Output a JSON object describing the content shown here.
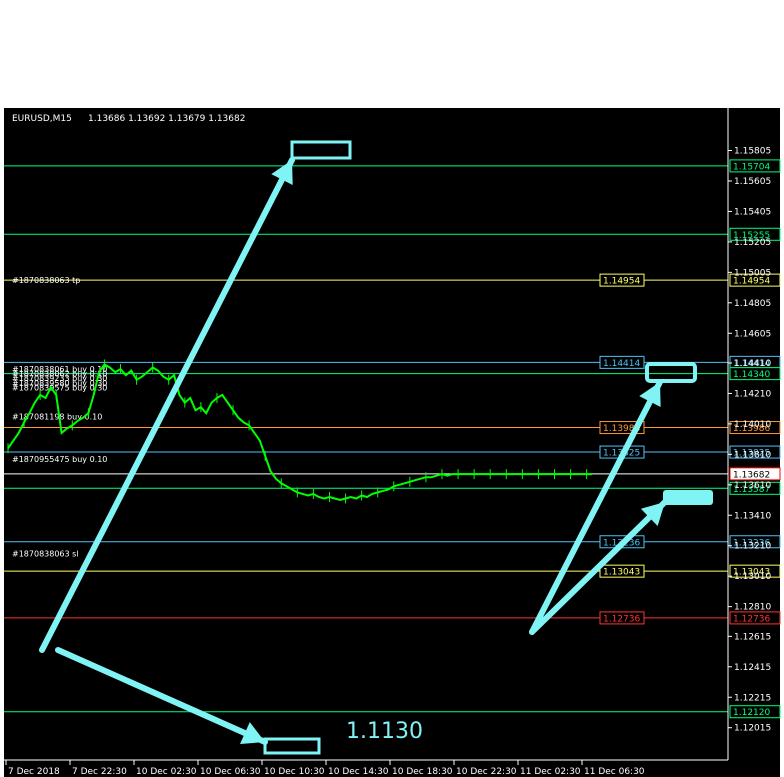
{
  "header": {
    "symbol": "EURUSD,M15",
    "ohlc": "1.13686 1.13692 1.13679 1.13682"
  },
  "colors": {
    "bg": "#000000",
    "axis": "#ffffff",
    "candle": "#00ff00",
    "green_line": "#00ff7f",
    "yellow_line": "#ffff66",
    "blue_line": "#4fc3f7",
    "orange_line": "#ff9933",
    "red_line": "#ff3333",
    "arrow": "#80f4f4"
  },
  "chart_data": {
    "type": "line",
    "title": "",
    "ylim": [
      1.12,
      1.1592
    ],
    "y_ticks": [
      "1.15805",
      "1.15605",
      "1.15405",
      "1.15205",
      "1.15005",
      "1.14805",
      "1.14605",
      "1.14410",
      "1.14210",
      "1.14010",
      "1.13810",
      "1.13610",
      "1.13410",
      "1.13210",
      "1.13010",
      "1.12810",
      "1.12615",
      "1.12415",
      "1.12215",
      "1.12015"
    ],
    "x_ticks": [
      "7 Dec 2018",
      "7 Dec 22:30",
      "10 Dec 02:30",
      "10 Dec 06:30",
      "10 Dec 10:30",
      "10 Dec 14:30",
      "10 Dec 18:30",
      "10 Dec 22:30",
      "11 Dec 02:30",
      "11 Dec 06:30"
    ],
    "price_levels": [
      {
        "price": 1.15704,
        "label": "1.15704",
        "style": "green"
      },
      {
        "price": 1.15255,
        "label": "1.15255",
        "style": "green"
      },
      {
        "price": 1.14954,
        "label": "1.14954",
        "style": "yellow"
      },
      {
        "price": 1.14414,
        "label": "1.14414",
        "style": "blue"
      },
      {
        "price": 1.1434,
        "label": "1.14340",
        "style": "green"
      },
      {
        "price": 1.13986,
        "label": "1.13986",
        "style": "orange"
      },
      {
        "price": 1.13825,
        "label": "1.13825",
        "style": "blue"
      },
      {
        "price": 1.13682,
        "label": "1.13682",
        "style": "current"
      },
      {
        "price": 1.13587,
        "label": "1.13587",
        "style": "green"
      },
      {
        "price": 1.13236,
        "label": "1.13236",
        "style": "blue"
      },
      {
        "price": 1.13043,
        "label": "1.13043",
        "style": "yellow"
      },
      {
        "price": 1.12736,
        "label": "1.12736",
        "style": "red"
      },
      {
        "price": 1.1212,
        "label": "1.12120",
        "style": "green"
      }
    ],
    "order_labels": [
      {
        "price": 1.14954,
        "text": "#1870838063 tp"
      },
      {
        "price": 1.1437,
        "text": "#1870838061 buy 0.10"
      },
      {
        "price": 1.1434,
        "text": "#1870838062 buy 0.10"
      },
      {
        "price": 1.1431,
        "text": "#1870839233 buy 0.30"
      },
      {
        "price": 1.1428,
        "text": "#1870839580 buy 0.30"
      },
      {
        "price": 1.1425,
        "text": "#1870839575 buy 0.30"
      },
      {
        "price": 1.1406,
        "text": "#187081198 buy 0.10"
      },
      {
        "price": 1.1378,
        "text": "#1870955475 buy 0.10"
      },
      {
        "price": 1.1316,
        "text": "#1870838063 sl"
      }
    ],
    "series": [
      {
        "x": [
          0,
          2,
          4,
          6,
          8,
          10,
          12,
          14,
          16,
          18,
          20,
          22,
          24,
          26,
          28,
          30,
          32,
          34,
          36,
          38,
          40,
          42,
          44,
          46,
          48,
          50,
          52,
          54,
          56,
          58,
          60,
          62,
          64,
          66,
          68,
          70,
          72,
          74,
          76,
          78,
          80,
          82,
          84,
          86,
          88,
          90,
          92,
          94,
          96,
          98,
          100,
          102,
          104,
          106,
          108,
          110,
          112,
          114,
          116,
          118,
          120,
          122,
          124,
          126,
          128,
          130,
          132,
          134,
          136,
          138,
          140,
          142,
          144,
          146,
          148,
          150,
          152,
          154,
          156,
          158,
          160,
          162,
          164,
          166,
          168,
          170,
          172,
          174,
          176,
          178,
          180,
          182,
          184,
          186,
          188,
          190,
          192,
          194,
          196,
          198,
          200,
          202,
          204,
          206,
          208,
          210,
          212,
          214,
          216,
          218
        ],
        "values": [
          1.1385,
          1.139,
          1.1395,
          1.1402,
          1.1408,
          1.1415,
          1.142,
          1.1418,
          1.1425,
          1.142,
          1.1395,
          1.1398,
          1.14,
          1.1403,
          1.1405,
          1.1408,
          1.142,
          1.1435,
          1.144,
          1.1438,
          1.1435,
          1.1437,
          1.1433,
          1.1436,
          1.143,
          1.1432,
          1.1435,
          1.1438,
          1.1436,
          1.1432,
          1.143,
          1.1433,
          1.142,
          1.1415,
          1.1418,
          1.141,
          1.1412,
          1.1408,
          1.1415,
          1.1418,
          1.142,
          1.1415,
          1.141,
          1.1405,
          1.1402,
          1.14,
          1.1395,
          1.139,
          1.138,
          1.137,
          1.1365,
          1.1362,
          1.136,
          1.1358,
          1.1356,
          1.1355,
          1.1354,
          1.1355,
          1.1353,
          1.1352,
          1.1353,
          1.1352,
          1.1351,
          1.1352,
          1.1353,
          1.1352,
          1.1354,
          1.1353,
          1.1355,
          1.1356,
          1.1357,
          1.1358,
          1.136,
          1.1361,
          1.1362,
          1.1363,
          1.1364,
          1.1365,
          1.1366,
          1.1366,
          1.1367,
          1.1368,
          1.1367,
          1.1368,
          1.1368,
          1.1368,
          1.1368,
          1.1368,
          1.1368,
          1.1368,
          1.1368,
          1.1368,
          1.1368,
          1.1368,
          1.1368,
          1.1368,
          1.1368,
          1.1368,
          1.1368,
          1.1368,
          1.1368,
          1.1368,
          1.1368,
          1.1368,
          1.1368,
          1.1368,
          1.1368,
          1.1368,
          1.1368,
          1.1368
        ]
      }
    ],
    "annotation": "1.1130"
  }
}
